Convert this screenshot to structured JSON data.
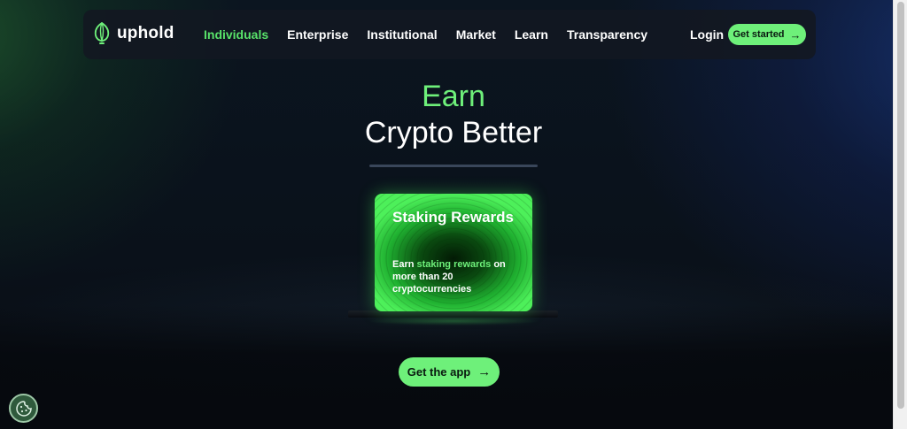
{
  "brand": {
    "name": "uphold",
    "accent": "#6ef07a"
  },
  "nav": {
    "items": [
      {
        "label": "Individuals",
        "active": true
      },
      {
        "label": "Enterprise",
        "active": false
      },
      {
        "label": "Institutional",
        "active": false
      },
      {
        "label": "Market",
        "active": false
      },
      {
        "label": "Learn",
        "active": false
      },
      {
        "label": "Transparency",
        "active": false
      }
    ],
    "login_label": "Login",
    "cta_label": "Get started",
    "cta_icon": "arrow-right-icon"
  },
  "hero": {
    "earn": "Earn",
    "title": "Crypto Better"
  },
  "card": {
    "title": "Staking Rewards",
    "desc_prefix": "Earn ",
    "desc_highlight": "staking rewards",
    "desc_suffix": " on more than 20 cryptocurrencies"
  },
  "app_cta": {
    "label": "Get the app",
    "icon": "arrow-right-icon"
  },
  "cookie": {
    "icon": "cookie-icon"
  }
}
